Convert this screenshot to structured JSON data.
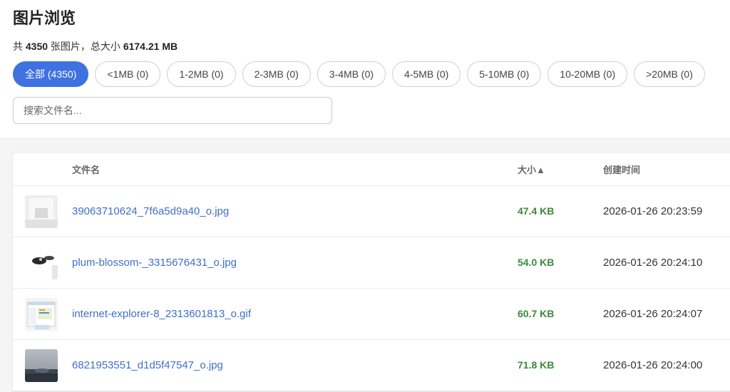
{
  "header": {
    "title": "图片浏览",
    "summary_prefix": "共 ",
    "count": "4350",
    "summary_mid": " 张图片，总大小 ",
    "total_size": "6174.21 MB"
  },
  "filters": [
    {
      "label": "全部 (4350)",
      "active": true
    },
    {
      "label": "<1MB (0)",
      "active": false
    },
    {
      "label": "1-2MB (0)",
      "active": false
    },
    {
      "label": "2-3MB (0)",
      "active": false
    },
    {
      "label": "3-4MB (0)",
      "active": false
    },
    {
      "label": "4-5MB (0)",
      "active": false
    },
    {
      "label": "5-10MB (0)",
      "active": false
    },
    {
      "label": "10-20MB (0)",
      "active": false
    },
    {
      "label": ">20MB (0)",
      "active": false
    }
  ],
  "search": {
    "placeholder": "搜索文件名...",
    "value": ""
  },
  "table": {
    "columns": {
      "name": "文件名",
      "size": "大小▲",
      "time": "创建时间"
    },
    "rows": [
      {
        "name": "39063710624_7f6a5d9a40_o.jpg",
        "size": "47.4 KB",
        "time": "2026-01-26 20:23:59"
      },
      {
        "name": "plum-blossom-_3315676431_o.jpg",
        "size": "54.0 KB",
        "time": "2026-01-26 20:24:10"
      },
      {
        "name": "internet-explorer-8_2313601813_o.gif",
        "size": "60.7 KB",
        "time": "2026-01-26 20:24:07"
      },
      {
        "name": "6821953551_d1d5f47547_o.jpg",
        "size": "71.8 KB",
        "time": "2026-01-26 20:24:00"
      }
    ]
  },
  "colors": {
    "accent": "#3f72e0",
    "link": "#3f6fc9",
    "size": "#3a8a3a"
  }
}
